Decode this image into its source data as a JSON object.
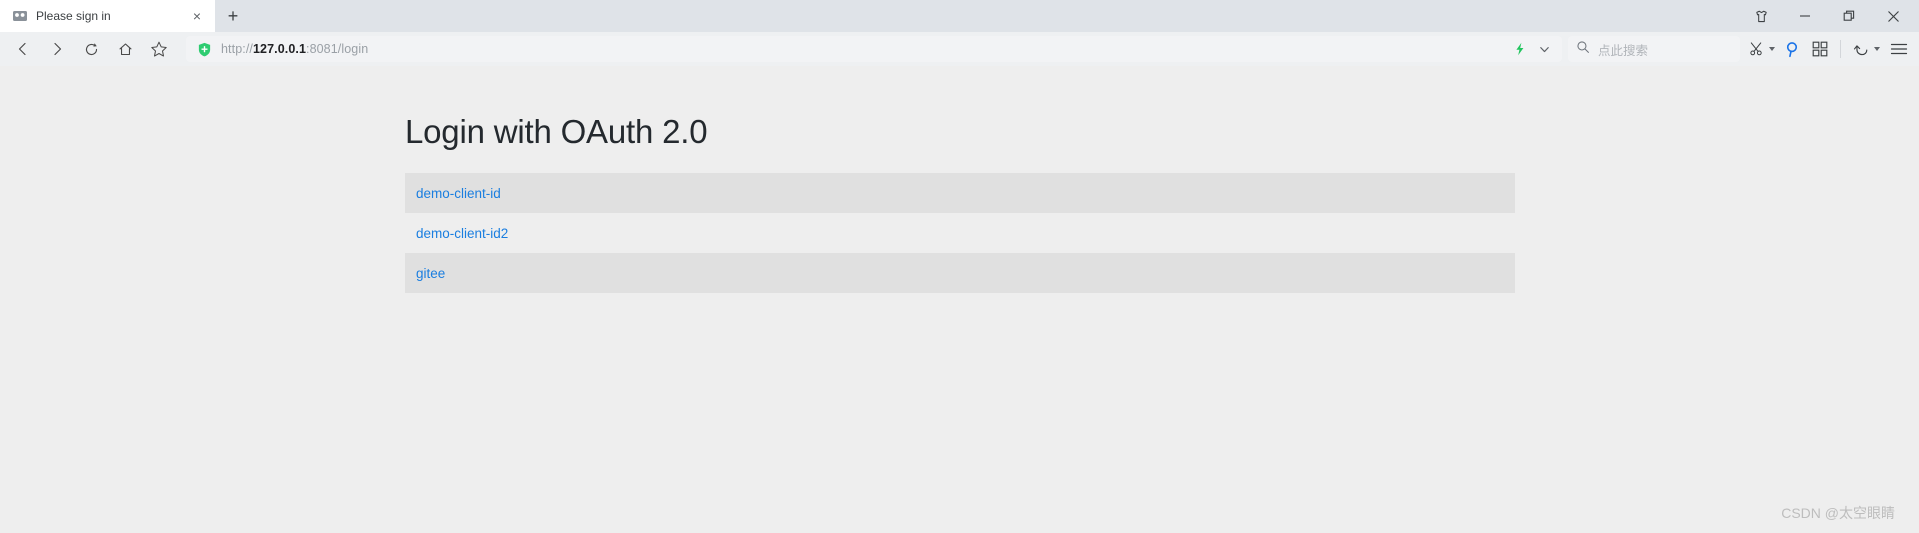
{
  "window": {
    "controls": [
      {
        "name": "skin-icon",
        "label": "Skin"
      },
      {
        "name": "minimize-button",
        "label": "Minimize"
      },
      {
        "name": "restore-button",
        "label": "Restore"
      },
      {
        "name": "close-button",
        "label": "Close"
      }
    ]
  },
  "tabs": [
    {
      "title": "Please sign in",
      "favicon": "default-page-icon",
      "close_label": "×",
      "active": true
    }
  ],
  "newtab": {
    "label": "+"
  },
  "nav": {
    "back": "back-icon",
    "forward": "forward-icon",
    "reload": "reload-icon",
    "home": "home-icon",
    "bookmark": "star-icon"
  },
  "omnibox": {
    "security_icon": "green-shield-icon",
    "url_scheme": "http://",
    "url_host": "127.0.0.1",
    "url_rest": ":8081/login",
    "url_full": "http://127.0.0.1:8081/login",
    "turbo_icon": "lightning-bolt-icon",
    "dropdown_icon": "chevron-down-icon"
  },
  "search": {
    "icon": "search-icon",
    "placeholder": "点此搜索",
    "value": ""
  },
  "toolbar_right": {
    "screenshot": {
      "name": "scissors-icon",
      "label": "Screenshot"
    },
    "find": {
      "name": "magnifier-icon",
      "label": "Find"
    },
    "apps": {
      "name": "grid-icon",
      "label": "Apps"
    },
    "history": {
      "name": "undo-icon",
      "label": "History"
    },
    "menu": {
      "name": "hamburger-menu-icon",
      "label": "Menu"
    }
  },
  "page": {
    "title": "Login with OAuth 2.0",
    "clients": [
      {
        "label": "demo-client-id",
        "striped": true
      },
      {
        "label": "demo-client-id2",
        "striped": false
      },
      {
        "label": "gitee",
        "striped": true
      }
    ]
  },
  "watermark": {
    "text": "CSDN @太空眼睛"
  },
  "colors": {
    "accent_link": "#1a7ee0",
    "page_background": "#eeeeee",
    "row_striped": "#e0e0e0",
    "shield_green": "#2ecc71",
    "bolt_green": "#22c55e",
    "find_blue": "#1a73e8"
  }
}
